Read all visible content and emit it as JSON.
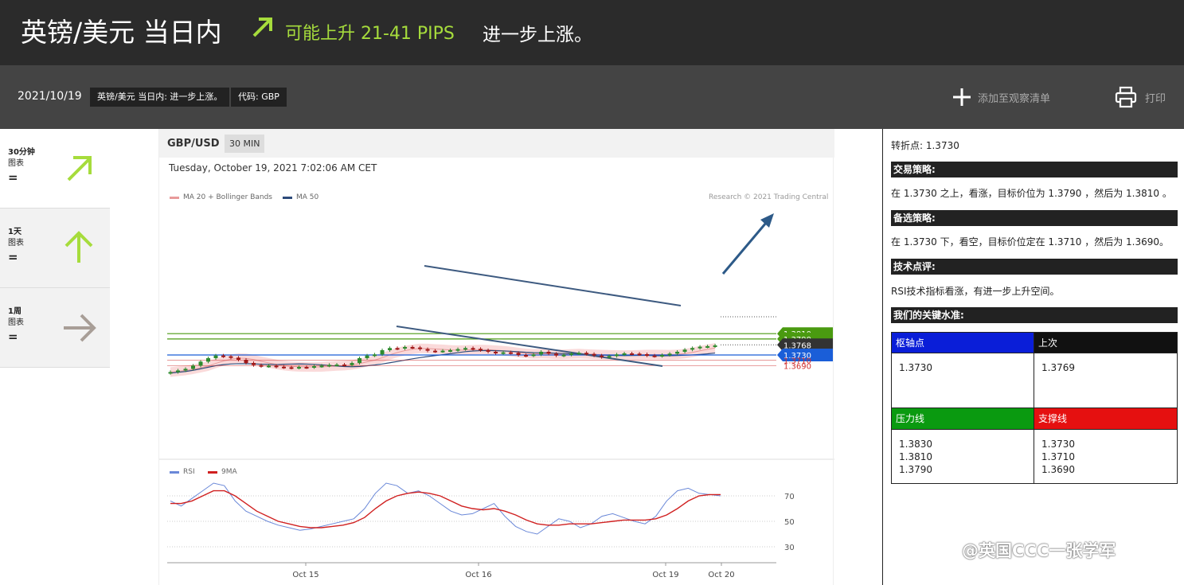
{
  "header": {
    "title": "英镑/美元 当日内",
    "trend_text": "可能上升 21-41 PIPS",
    "subtitle": "进一步上涨。",
    "accent_color": "#a6dc3c"
  },
  "toolbar": {
    "date": "2021/10/19",
    "tag_title": "英镑/美元 当日内: 进一步上涨。",
    "tag_code": "代码: GBP",
    "watchlist_label": "添加至观察清单",
    "print_label": "打印"
  },
  "timeframes": [
    {
      "name": "30分钟",
      "sub": "图表",
      "eq": "=",
      "icon": "arrow-up-right-icon",
      "color": "#a6dc3c"
    },
    {
      "name": "1天",
      "sub": "图表",
      "eq": "=",
      "icon": "arrow-up-icon",
      "color": "#a6dc3c"
    },
    {
      "name": "1周",
      "sub": "图表",
      "eq": "=",
      "icon": "arrow-right-icon",
      "color": "#a89e97"
    }
  ],
  "chart": {
    "pair": "GBP/USD",
    "timeframe": "30 MIN",
    "datetime": "Tuesday, October 19, 2021 7:02:06 AM CET",
    "legend_ma20": "MA 20 + Bollinger Bands",
    "legend_ma50": "MA 50",
    "copyright": "Research © 2021 Trading Central",
    "rsi_legend": "RSI",
    "rsi_ma_legend": "9MA"
  },
  "chart_data": [
    {
      "type": "candlestick",
      "title": "GBP/USD",
      "x_ticks": [
        "Oct 15",
        "Oct 16",
        "Oct 19",
        "Oct 20"
      ],
      "levels": [
        {
          "label": "1.3810",
          "value": 1.381,
          "color": "#4a9a10"
        },
        {
          "label": "1.3790",
          "value": 1.379,
          "color": "#4a9a10"
        },
        {
          "label": "1.3768",
          "value": 1.3768,
          "color": "#333333"
        },
        {
          "label": "1.3730",
          "value": 1.373,
          "color": "#1a5ed8"
        },
        {
          "label": "1.3710",
          "value": 1.371,
          "color": "#d03030"
        },
        {
          "label": "1.3690",
          "value": 1.369,
          "color": "#d03030"
        }
      ],
      "close_path": [
        1.3666,
        1.3672,
        1.3678,
        1.369,
        1.3705,
        1.3718,
        1.3728,
        1.3725,
        1.372,
        1.3712,
        1.37,
        1.3692,
        1.3688,
        1.369,
        1.3686,
        1.3684,
        1.3682,
        1.3685,
        1.3684,
        1.3688,
        1.369,
        1.3693,
        1.3694,
        1.3692,
        1.37,
        1.3718,
        1.3728,
        1.3732,
        1.3748,
        1.3756,
        1.3754,
        1.376,
        1.3758,
        1.3752,
        1.3746,
        1.3744,
        1.3746,
        1.3748,
        1.3752,
        1.3756,
        1.3753,
        1.3748,
        1.3742,
        1.3737,
        1.374,
        1.3738,
        1.373,
        1.3728,
        1.3732,
        1.3742,
        1.3735,
        1.3728,
        1.3731,
        1.3736,
        1.3738,
        1.3734,
        1.3728,
        1.3722,
        1.3726,
        1.3732,
        1.3736,
        1.3735,
        1.3733,
        1.3728,
        1.3726,
        1.373,
        1.3735,
        1.3742,
        1.375,
        1.3756,
        1.3761,
        1.3763,
        1.3766
      ]
    },
    {
      "type": "line",
      "title": "RSI",
      "series": [
        {
          "name": "RSI",
          "values": [
            66,
            62,
            68,
            74,
            80,
            78,
            66,
            58,
            54,
            50,
            47,
            45,
            43,
            44,
            46,
            48,
            50,
            52,
            60,
            72,
            80,
            78,
            72,
            74,
            70,
            64,
            58,
            55,
            56,
            60,
            64,
            54,
            46,
            42,
            40,
            46,
            52,
            50,
            45,
            48,
            54,
            56,
            53,
            50,
            48,
            54,
            66,
            74,
            76,
            72,
            71,
            70
          ]
        },
        {
          "name": "9MA",
          "values": [
            64,
            64,
            66,
            70,
            74,
            74,
            70,
            64,
            58,
            54,
            50,
            48,
            46,
            45,
            45,
            46,
            47,
            49,
            53,
            60,
            66,
            70,
            72,
            73,
            72,
            70,
            66,
            62,
            60,
            59,
            60,
            58,
            55,
            51,
            48,
            47,
            47,
            48,
            48,
            48,
            49,
            50,
            51,
            51,
            51,
            52,
            55,
            60,
            66,
            70,
            71,
            71
          ]
        }
      ],
      "y_ticks": [
        70,
        50,
        30
      ]
    }
  ],
  "right_panel": {
    "pivot_line": "转折点: 1.3730",
    "strategy_title": "交易策略:",
    "strategy_text": "在 1.3730 之上，看涨，目标价位为 1.3790 ，然后为 1.3810 。",
    "alt_title": "备选策略:",
    "alt_text": "在 1.3730 下，看空，目标价位定在 1.3710 ，然后为 1.3690。",
    "tech_title": "技术点评:",
    "tech_text": "RSI技术指标看涨，有进一步上升空间。",
    "levels_title": "我们的关键水准:",
    "table": {
      "pivot_label": "枢轴点",
      "pivot_value": "1.3730",
      "last_label": "上次",
      "last_value": "1.3769",
      "resist_label": "压力线",
      "resist_values": [
        "1.3830",
        "1.3810",
        "1.3790"
      ],
      "support_label": "支撑线",
      "support_values": [
        "1.3730",
        "1.3710",
        "1.3690"
      ],
      "pivot_color": "#0a1ed8",
      "resist_color": "#0a9a10",
      "support_color": "#e51010"
    }
  },
  "watermark": "@英国CCC一张学军"
}
